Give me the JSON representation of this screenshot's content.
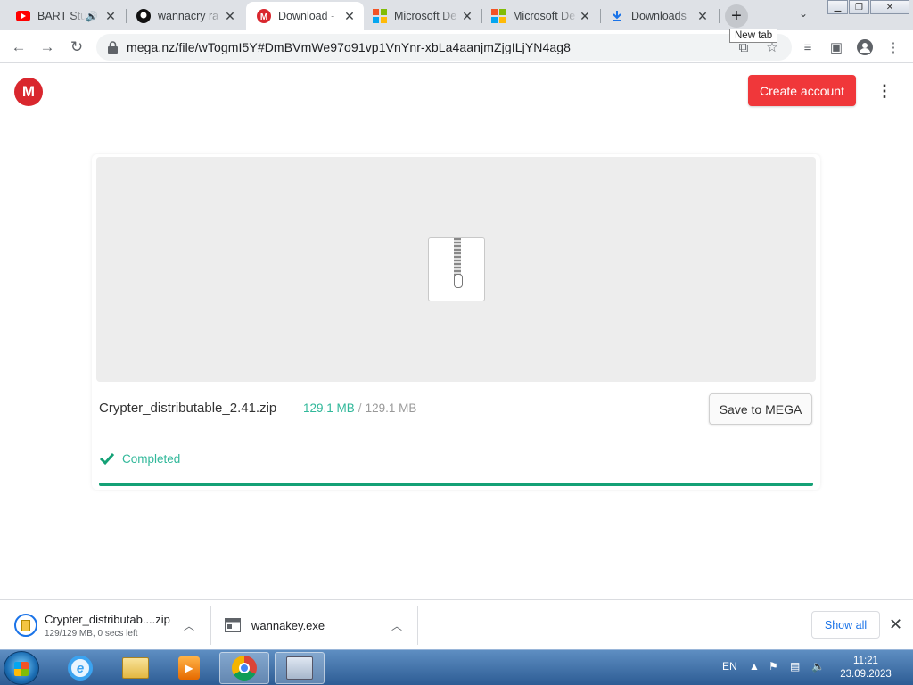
{
  "tabs": [
    {
      "title": "BART Stu",
      "favicon": "youtube-icon",
      "has_sound": true
    },
    {
      "title": "wannacry ra",
      "favicon": "github-icon"
    },
    {
      "title": "Download - ",
      "favicon": "mega-icon",
      "active": true
    },
    {
      "title": "Microsoft De",
      "favicon": "microsoft-icon"
    },
    {
      "title": "Microsoft De",
      "favicon": "microsoft-icon"
    },
    {
      "title": "Downloads",
      "favicon": "download-icon"
    }
  ],
  "tooltip": "New tab",
  "address_bar": {
    "url": "mega.nz/file/wTogmI5Y#DmBVmWe97o91vp1VnYnr-xbLa4aanjmZjgILjYN4ag8"
  },
  "header": {
    "logo": "M",
    "create_account": "Create account"
  },
  "file": {
    "name": "Crypter_distributable_2.41.zip",
    "downloaded": "129.1 MB",
    "separator": "/",
    "total": "129.1 MB",
    "save_label": "Save to MEGA",
    "status": "Completed",
    "progress": 1.0
  },
  "downloads_shelf": {
    "items": [
      {
        "name": "Crypter_distributab....zip",
        "detail": "129/129 MB, 0 secs left"
      },
      {
        "name": "wannakey.exe",
        "detail": ""
      }
    ],
    "show_all": "Show all"
  },
  "taskbar": {
    "language": "EN",
    "time": "11:21",
    "date": "23.09.2023"
  },
  "colors": {
    "mega_red": "#d9272e",
    "create_button": "#f0373a",
    "success_green": "#31b89a",
    "progress_green": "#14a176"
  }
}
